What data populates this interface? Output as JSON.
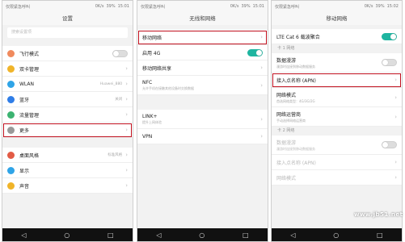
{
  "status": {
    "left": "仅限紧急呼叫",
    "right": "0K/s",
    "battery": "39%",
    "time": "15:01",
    "time3": "15:02"
  },
  "screen1": {
    "title": "设置",
    "search_placeholder": "搜索设置项",
    "items": [
      {
        "label": "飞行模式",
        "icon_color": "#f08a5d"
      },
      {
        "label": "双卡管理",
        "icon_color": "#f0b429"
      },
      {
        "label": "WLAN",
        "value": "Huawei_880",
        "icon_color": "#2fa4e7"
      },
      {
        "label": "蓝牙",
        "value": "关闭",
        "icon_color": "#2f7de7"
      },
      {
        "label": "流量管理",
        "icon_color": "#3cb371"
      },
      {
        "label": "更多",
        "icon_color": "#999999"
      },
      {
        "label": "桌面风格",
        "value": "标准风格",
        "icon_color": "#e25b45"
      },
      {
        "label": "显示",
        "icon_color": "#2fa4e7"
      },
      {
        "label": "声音",
        "icon_color": "#f0b429"
      }
    ]
  },
  "screen2": {
    "title": "无线和网络",
    "items": [
      {
        "label": "移动网络"
      },
      {
        "label": "启用 4G"
      },
      {
        "label": "移动网络共享"
      },
      {
        "label": "NFC",
        "sub": "允许手机在接触其他设备时交换数据"
      },
      {
        "label": "LINK+",
        "sub": "提升上网体验"
      },
      {
        "label": "VPN"
      }
    ]
  },
  "screen3": {
    "title": "移动网络",
    "top_item": "LTE Cat 6 载波聚合",
    "card1_label": "卡 1 网络",
    "card1_items": [
      {
        "label": "数据漫游",
        "sub": "漫游时连接到移动数据服务"
      },
      {
        "label": "接入点名称 (APN)"
      },
      {
        "label": "网络模式",
        "sub": "首选网络类型：4G/3G/2G"
      },
      {
        "label": "网络运营商",
        "sub": "手动选择网络运营商"
      }
    ],
    "card2_label": "卡 2 网络",
    "card2_items": [
      {
        "label": "数据漫游",
        "sub": "漫游时连接到移动数据服务"
      },
      {
        "label": "接入点名称 (APN)"
      },
      {
        "label": "网络模式"
      }
    ]
  },
  "navbar": {
    "back": "◁",
    "home": "○",
    "recent": "□"
  },
  "watermark": "www.jb51.net"
}
